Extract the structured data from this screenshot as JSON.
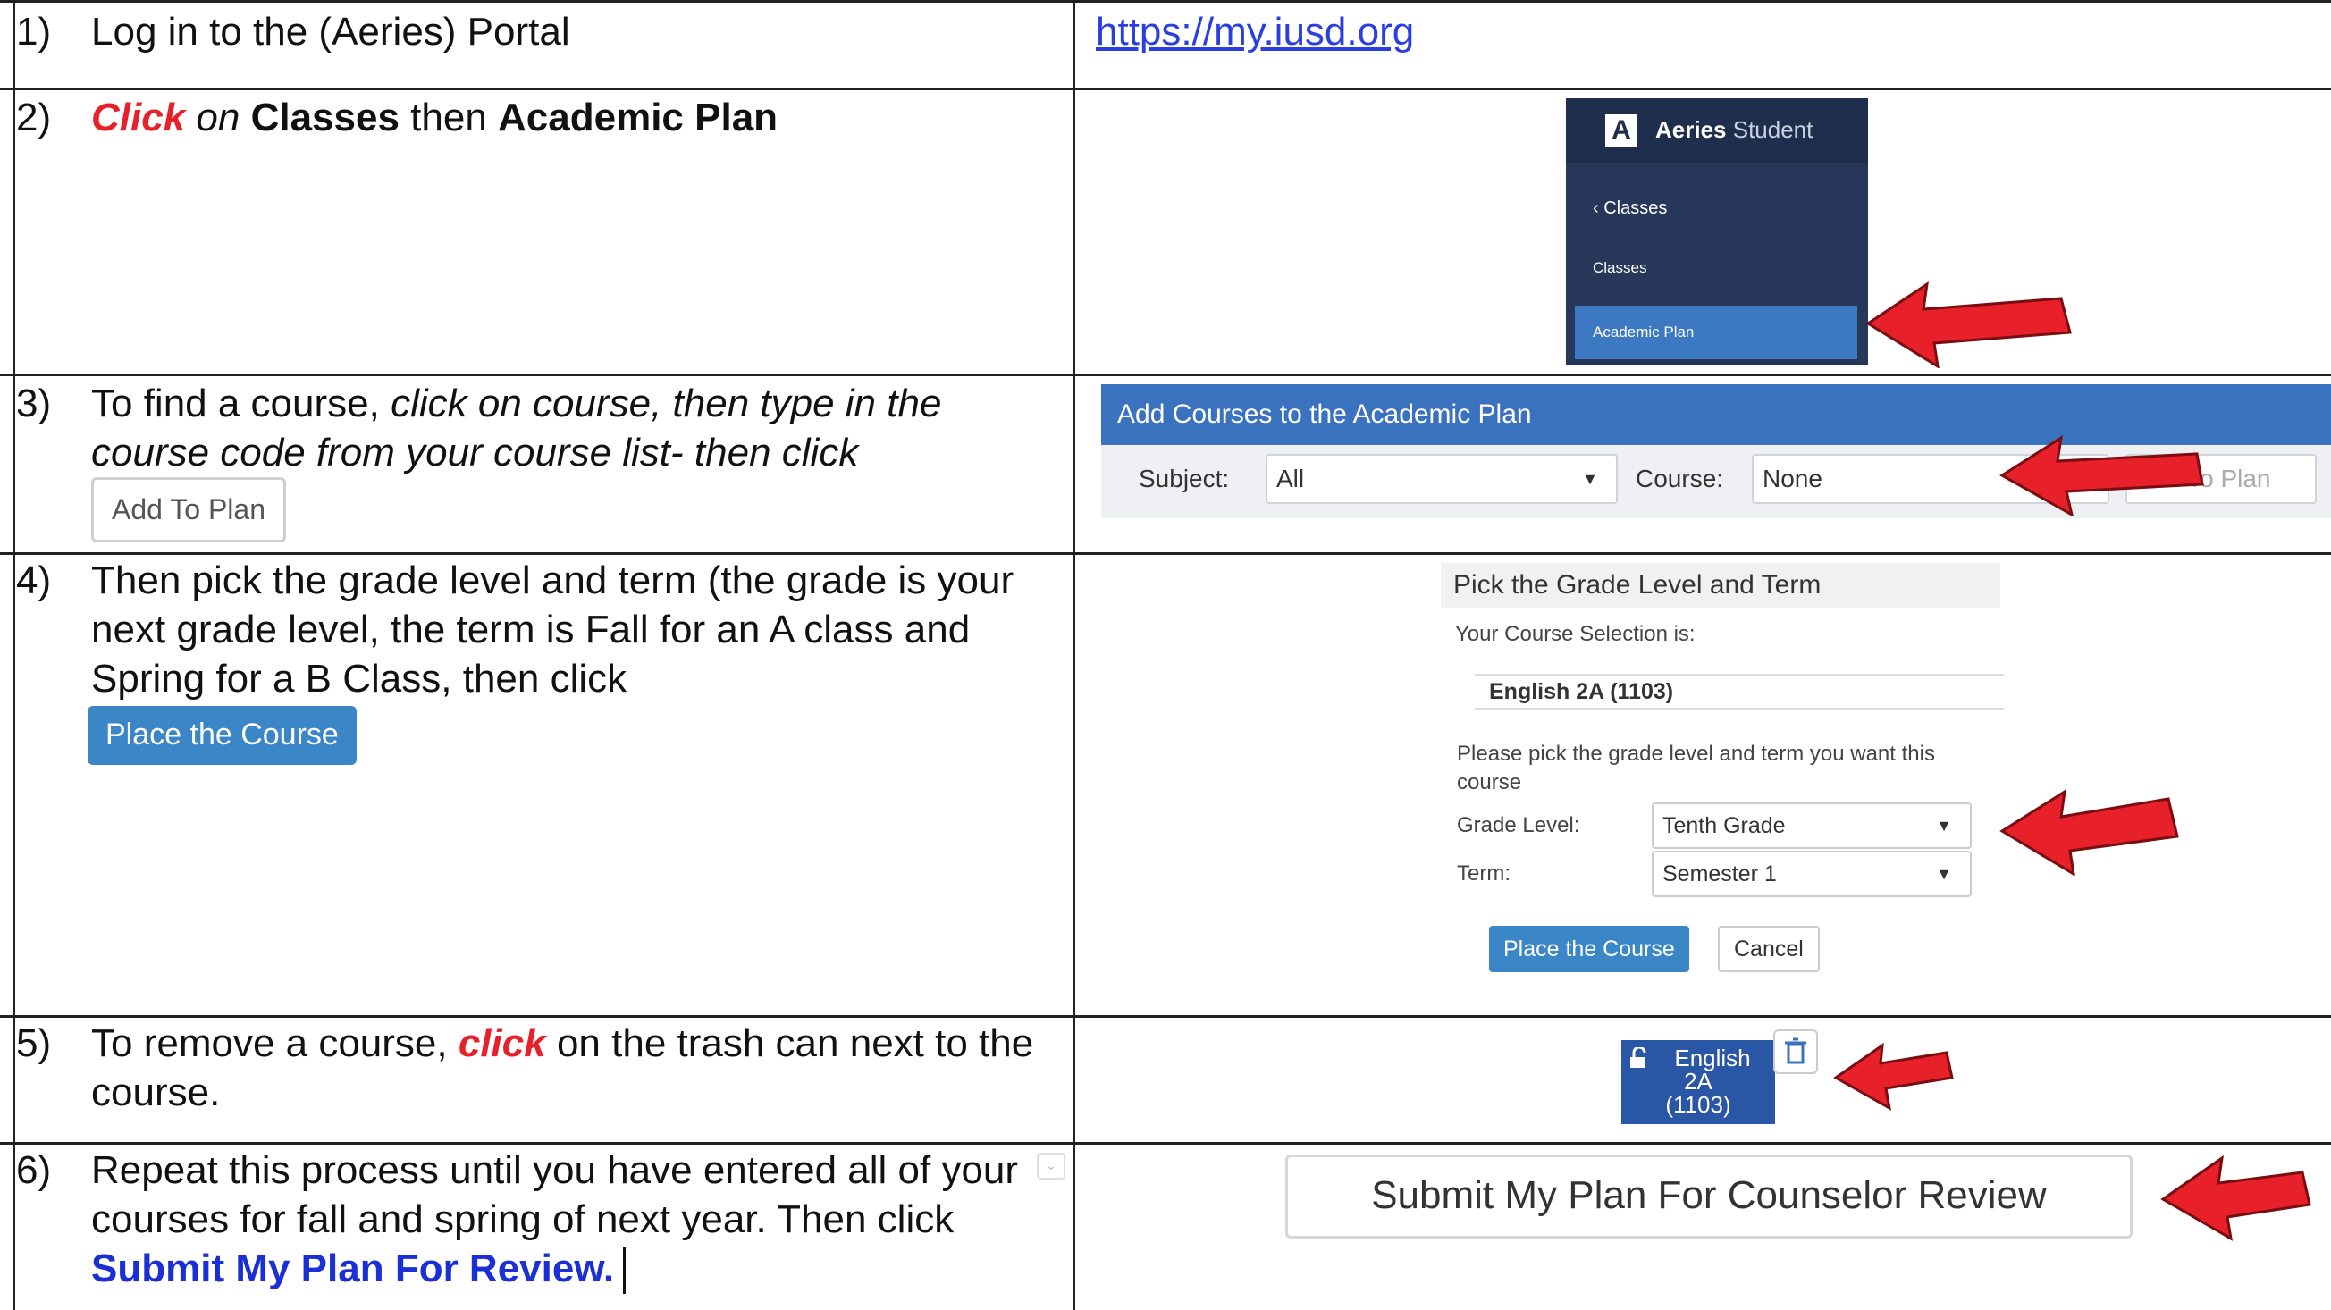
{
  "steps": {
    "s1": {
      "num": "1)",
      "text": "Log in to the (Aeries) Portal",
      "link": "https://my.iusd.org"
    },
    "s2": {
      "num": "2)",
      "t1": "Click",
      "t2": " on ",
      "t3": "Classes",
      "t4": " then ",
      "t5": "Academic Plan"
    },
    "s3": {
      "num": "3)",
      "t1": "To find a course, ",
      "t2": "click on course, then type in the course code from your course list- then click",
      "btn": "Add To Plan"
    },
    "s4": {
      "num": "4)",
      "text": "Then pick the grade level and term (the grade is your next grade level, the term is Fall for an A class and Spring for a B Class, then click",
      "btn": "Place the Course"
    },
    "s5": {
      "num": "5)",
      "t1": "To remove a course, ",
      "t2": "click",
      "t3": " on the trash can next to the course."
    },
    "s6": {
      "num": "6)",
      "t1": "Repeat this process until you have entered all of your courses for fall and spring of next year. Then click ",
      "t2": "Submit My Plan For Review."
    }
  },
  "aeries": {
    "logo": "A",
    "brand_bold": "Aeries",
    "brand_rest": " Student",
    "back_item": "‹  Classes",
    "item_classes": "Classes",
    "item_academic": "Academic Plan"
  },
  "add_panel": {
    "title": "Add Courses to the Academic Plan",
    "subject_label": "Subject:",
    "subject_value": "All",
    "course_label": "Course:",
    "course_value": "None",
    "add_btn": "Add To Plan"
  },
  "grade_dialog": {
    "title": "Pick the Grade Level and Term",
    "selection_label": "Your Course Selection is:",
    "selection_value": "English 2A (1103)",
    "instructions": "Please pick the grade level and term you want this course",
    "grade_label": "Grade Level:",
    "grade_value": "Tenth Grade",
    "term_label": "Term:",
    "term_value": "Semester 1",
    "place_btn": "Place the Course",
    "cancel_btn": "Cancel"
  },
  "chip": {
    "line1": "English",
    "line2": "2A",
    "line3": "(1103)"
  },
  "submit_btn": "Submit My Plan For Counselor Review",
  "colors": {
    "arrow": "#e8202a",
    "accent_blue": "#3a72c0"
  }
}
